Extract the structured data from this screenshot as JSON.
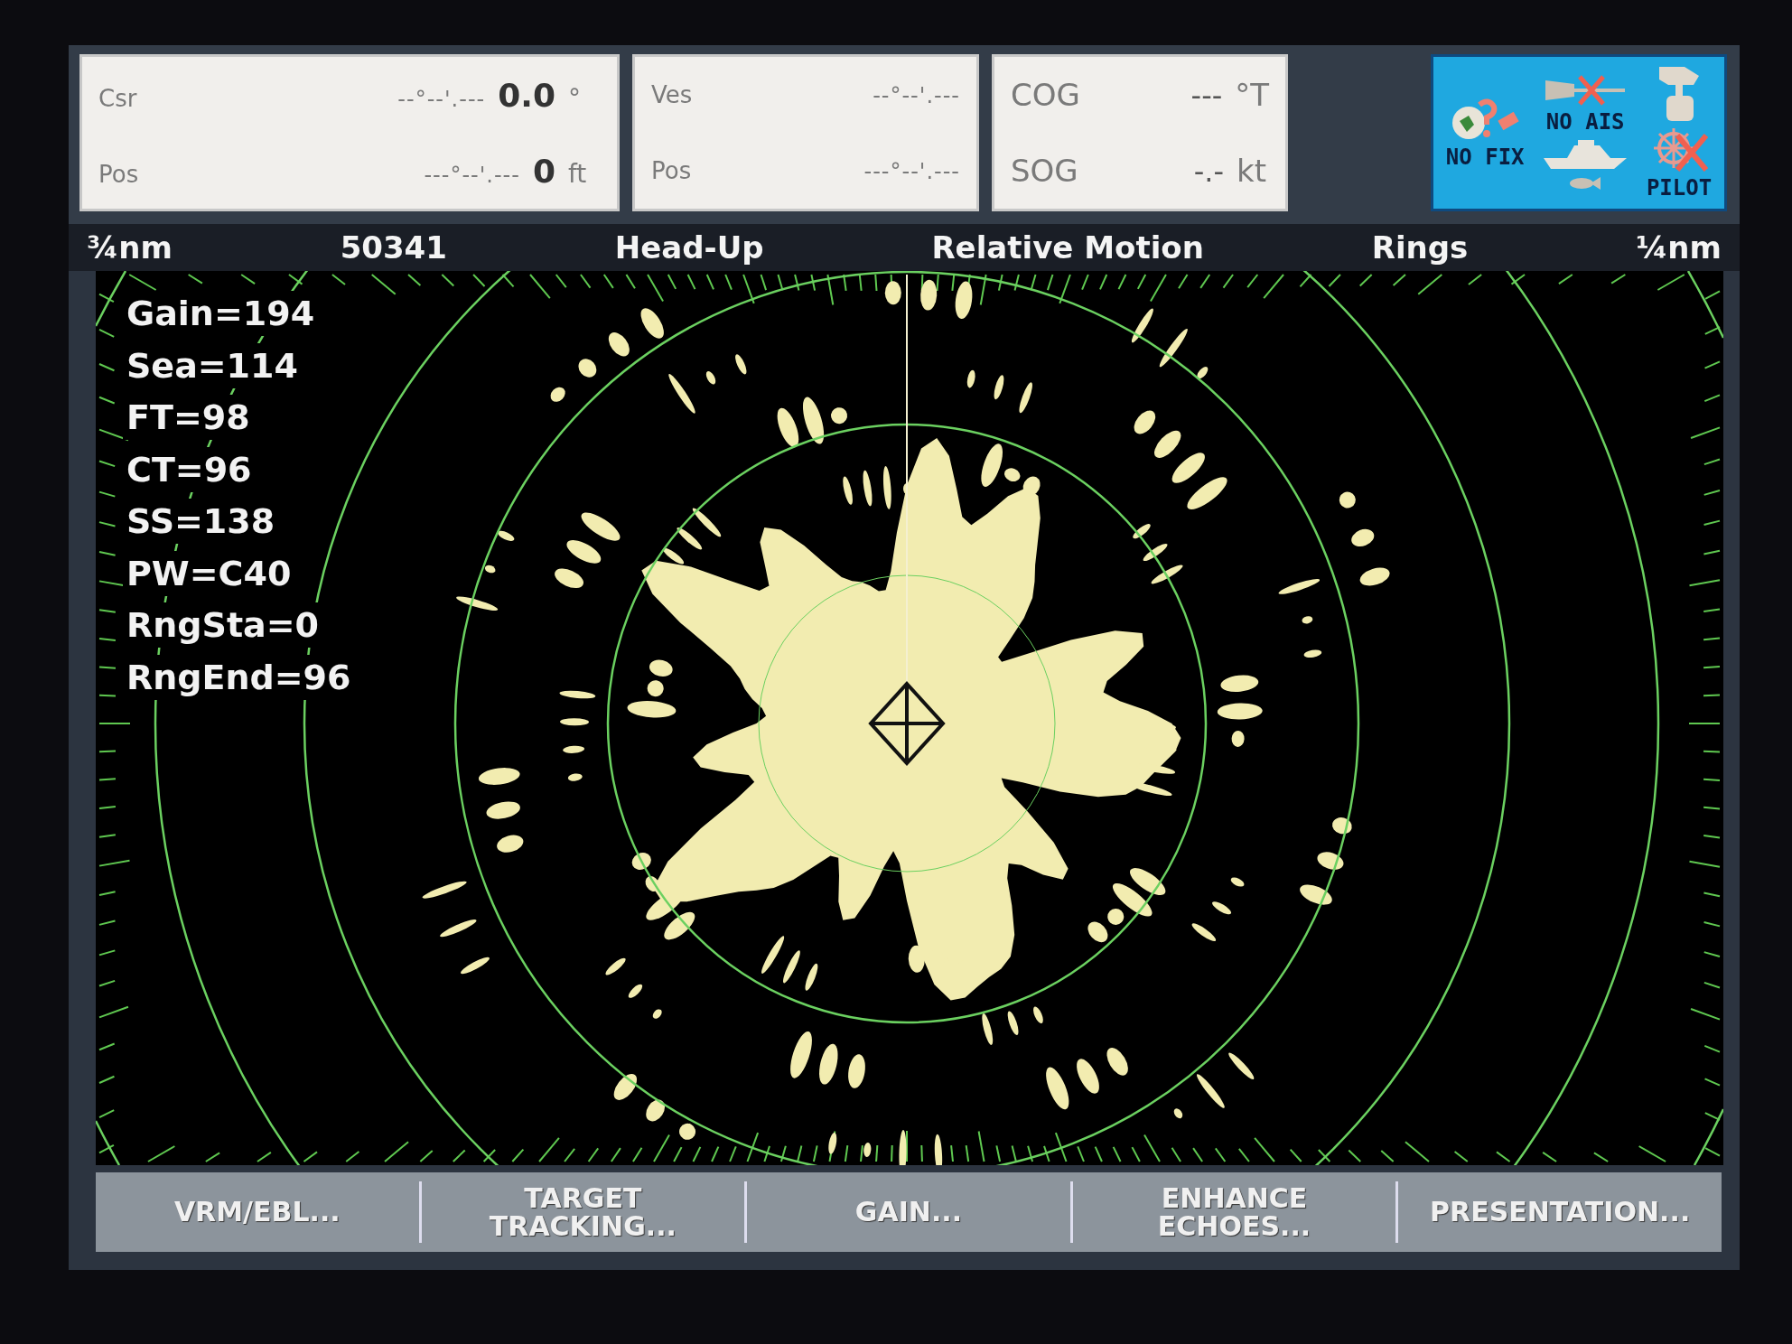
{
  "data_boxes": [
    {
      "rows": [
        {
          "label": "Csr",
          "position": "--°--'.---",
          "value": "0.0",
          "unit": "°"
        },
        {
          "label": "Pos",
          "position": "---°--'.---",
          "value": "0",
          "unit": "ft"
        }
      ]
    },
    {
      "rows": [
        {
          "label": "Ves",
          "position": "--°--'.---"
        },
        {
          "label": "Pos",
          "position": "---°--'.---"
        }
      ]
    },
    {
      "rows": [
        {
          "label": "COG",
          "value": "---",
          "unit": "°T"
        },
        {
          "label": "SOG",
          "value": "-.-",
          "unit": "kt"
        }
      ]
    }
  ],
  "status": {
    "fix": "NO FIX",
    "ais": "NO AIS",
    "pilot": "PILOT"
  },
  "header": {
    "range": "¾nm",
    "number": "50341",
    "orientation": "Head-Up",
    "motion": "Relative Motion",
    "rings_label": "Rings",
    "ring_spacing": "¼nm"
  },
  "radar_settings": [
    "Gain=194",
    "Sea=114",
    "FT=98",
    "CT=96",
    "SS=138",
    "PW=C40",
    "RngSta=0",
    "RngEnd=96"
  ],
  "softkeys": [
    {
      "lines": [
        "VRM/EBL..."
      ]
    },
    {
      "lines": [
        "TARGET",
        "TRACKING..."
      ]
    },
    {
      "lines": [
        "GAIN..."
      ]
    },
    {
      "lines": [
        "ENHANCE",
        "ECHOES..."
      ]
    },
    {
      "lines": [
        "PRESENTATION..."
      ]
    }
  ]
}
